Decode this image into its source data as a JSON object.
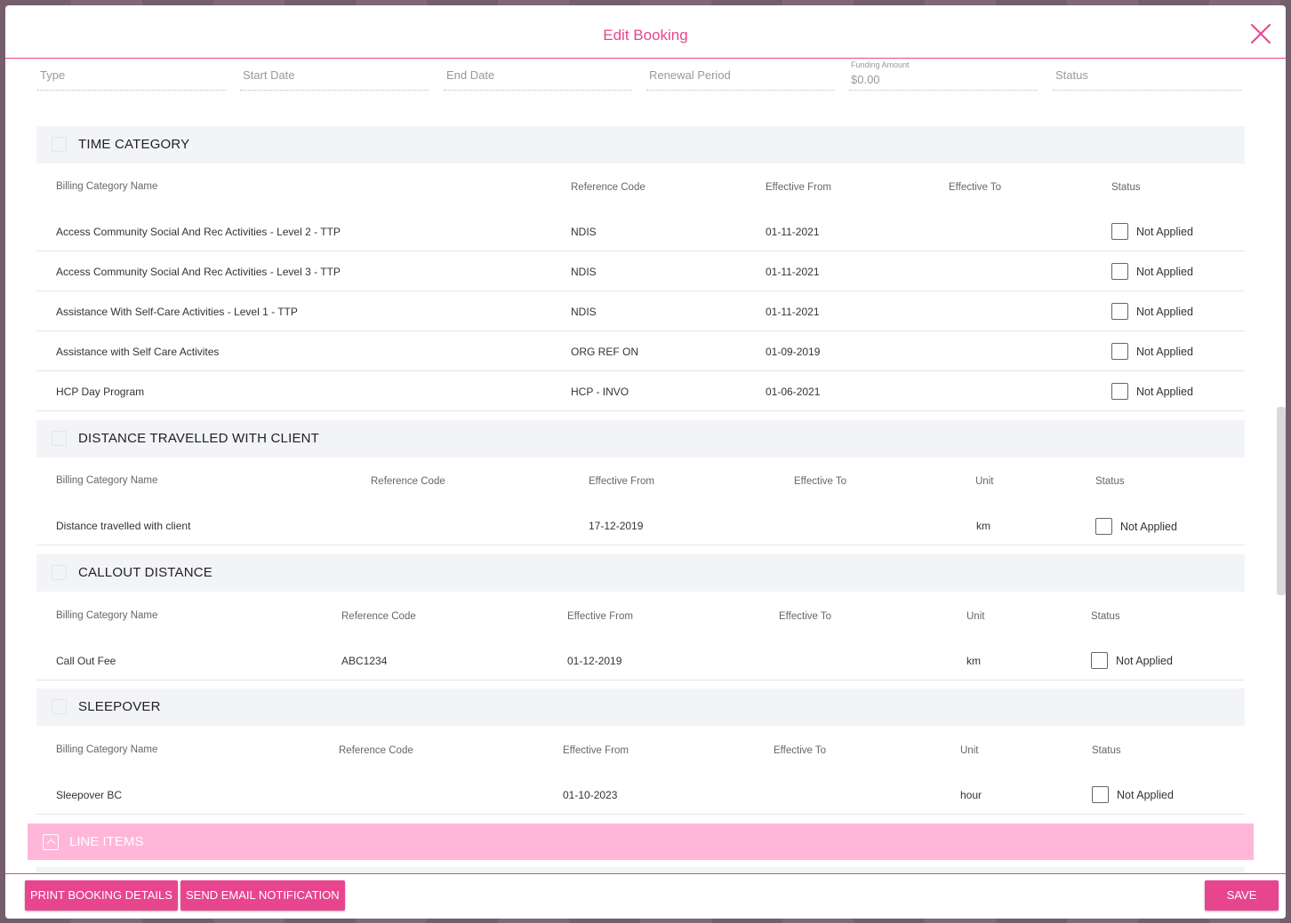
{
  "modal": {
    "title": "Edit Booking"
  },
  "fields": [
    {
      "placeholder": "Type"
    },
    {
      "placeholder": "Start Date"
    },
    {
      "placeholder": "End Date"
    },
    {
      "placeholder": "Renewal Period"
    },
    {
      "label": "Funding Amount",
      "value": "$0.00"
    },
    {
      "placeholder": "Status"
    }
  ],
  "time_category": {
    "title": "TIME CATEGORY",
    "headers": [
      "Billing Category Name",
      "Reference Code",
      "Effective From",
      "Effective To",
      "Status"
    ],
    "rows": [
      {
        "name": "Access Community Social And Rec Activities - Level 2 - TTP",
        "ref": "NDIS",
        "from": "01-11-2021",
        "to": "",
        "status": "Not Applied"
      },
      {
        "name": "Access Community Social And Rec Activities - Level 3 - TTP",
        "ref": "NDIS",
        "from": "01-11-2021",
        "to": "",
        "status": "Not Applied"
      },
      {
        "name": "Assistance With Self-Care Activities - Level 1 - TTP",
        "ref": "NDIS",
        "from": "01-11-2021",
        "to": "",
        "status": "Not Applied"
      },
      {
        "name": "Assistance with Self Care Activites",
        "ref": "ORG REF ON",
        "from": "01-09-2019",
        "to": "",
        "status": "Not Applied"
      },
      {
        "name": "HCP Day Program",
        "ref": "HCP - INVO",
        "from": "01-06-2021",
        "to": "",
        "status": "Not Applied"
      }
    ]
  },
  "distance_travelled": {
    "title": "DISTANCE TRAVELLED WITH CLIENT",
    "headers": [
      "Billing Category Name",
      "Reference Code",
      "Effective From",
      "Effective To",
      "Unit",
      "Status"
    ],
    "rows": [
      {
        "name": "Distance travelled with client",
        "ref": "",
        "from": "17-12-2019",
        "to": "",
        "unit": "km",
        "status": "Not Applied"
      }
    ]
  },
  "callout_distance": {
    "title": "CALLOUT DISTANCE",
    "headers": [
      "Billing Category Name",
      "Reference Code",
      "Effective From",
      "Effective To",
      "Unit",
      "Status"
    ],
    "rows": [
      {
        "name": "Call Out Fee",
        "ref": "ABC1234",
        "from": "01-12-2019",
        "to": "",
        "unit": "km",
        "status": "Not Applied"
      }
    ]
  },
  "sleepover": {
    "title": "SLEEPOVER",
    "headers": [
      "Billing Category Name",
      "Reference Code",
      "Effective From",
      "Effective To",
      "Unit",
      "Status"
    ],
    "rows": [
      {
        "name": "Sleepover BC",
        "ref": "",
        "from": "01-10-2023",
        "to": "",
        "unit": "hour",
        "status": "Not Applied"
      }
    ]
  },
  "line_items": {
    "title": "LINE ITEMS"
  },
  "footer": {
    "print_label": "PRINT BOOKING DETAILS",
    "email_label": "SEND EMAIL NOTIFICATION",
    "save_label": "SAVE"
  },
  "colors": {
    "accent": "#e8458f",
    "line_items_bg": "#ffb6d9",
    "section_bg": "#f3f4f7"
  }
}
